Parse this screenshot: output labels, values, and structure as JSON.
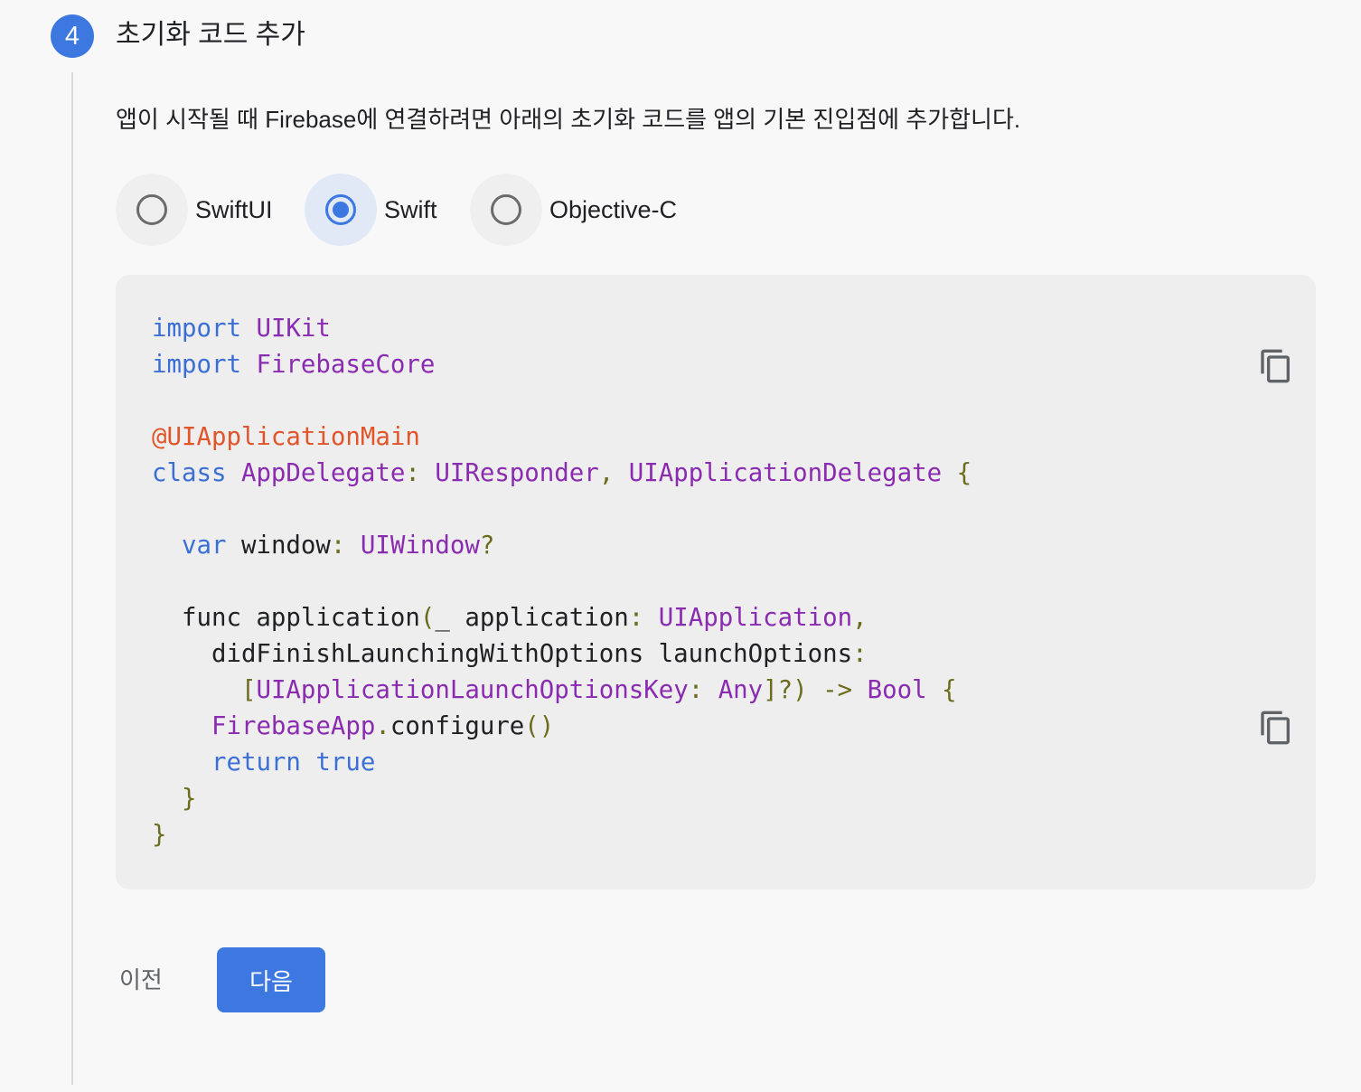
{
  "step": {
    "number": "4",
    "title": "초기화 코드 추가"
  },
  "description": "앱이 시작될 때 Firebase에 연결하려면 아래의 초기화 코드를 앱의 기본 진입점에 추가합니다.",
  "language_options": [
    {
      "label": "SwiftUI",
      "selected": false
    },
    {
      "label": "Swift",
      "selected": true
    },
    {
      "label": "Objective-C",
      "selected": false
    }
  ],
  "code_block": {
    "lines": [
      [
        [
          "kw",
          "import"
        ],
        [
          "pl",
          " "
        ],
        [
          "ty",
          "UIKit"
        ]
      ],
      [
        [
          "kw",
          "import"
        ],
        [
          "pl",
          " "
        ],
        [
          "ty",
          "FirebaseCore"
        ]
      ],
      [],
      [
        [
          "at",
          "@UIApplicationMain"
        ]
      ],
      [
        [
          "kw",
          "class"
        ],
        [
          "pl",
          " "
        ],
        [
          "ty",
          "AppDelegate"
        ],
        [
          "pn",
          ":"
        ],
        [
          "pl",
          " "
        ],
        [
          "ty",
          "UIResponder"
        ],
        [
          "pn",
          ","
        ],
        [
          "pl",
          " "
        ],
        [
          "ty",
          "UIApplicationDelegate"
        ],
        [
          "pl",
          " "
        ],
        [
          "pn",
          "{"
        ]
      ],
      [],
      [
        [
          "pl",
          "  "
        ],
        [
          "kw",
          "var"
        ],
        [
          "pl",
          " window"
        ],
        [
          "pn",
          ":"
        ],
        [
          "pl",
          " "
        ],
        [
          "ty",
          "UIWindow"
        ],
        [
          "pn",
          "?"
        ]
      ],
      [],
      [
        [
          "pl",
          "  func application"
        ],
        [
          "pn",
          "("
        ],
        [
          "pl",
          "_ application"
        ],
        [
          "pn",
          ":"
        ],
        [
          "pl",
          " "
        ],
        [
          "ty",
          "UIApplication"
        ],
        [
          "pn",
          ","
        ]
      ],
      [
        [
          "pl",
          "    didFinishLaunchingWithOptions launchOptions"
        ],
        [
          "pn",
          ":"
        ]
      ],
      [
        [
          "pl",
          "      "
        ],
        [
          "pn",
          "["
        ],
        [
          "ty",
          "UIApplicationLaunchOptionsKey"
        ],
        [
          "pn",
          ":"
        ],
        [
          "pl",
          " "
        ],
        [
          "ty",
          "Any"
        ],
        [
          "pn",
          "]?)"
        ],
        [
          "pl",
          " "
        ],
        [
          "pn",
          "->"
        ],
        [
          "pl",
          " "
        ],
        [
          "ty",
          "Bool"
        ],
        [
          "pl",
          " "
        ],
        [
          "pn",
          "{"
        ]
      ],
      [
        [
          "pl",
          "    "
        ],
        [
          "ty",
          "FirebaseApp"
        ],
        [
          "pn",
          "."
        ],
        [
          "pl",
          "configure"
        ],
        [
          "pn",
          "()"
        ]
      ],
      [
        [
          "pl",
          "    "
        ],
        [
          "kw",
          "return"
        ],
        [
          "pl",
          " "
        ],
        [
          "kw",
          "true"
        ]
      ],
      [
        [
          "pl",
          "  "
        ],
        [
          "pn",
          "}"
        ]
      ],
      [
        [
          "pn",
          "}"
        ]
      ]
    ]
  },
  "buttons": {
    "prev_label": "이전",
    "next_label": "다음"
  },
  "colors": {
    "accent": "#3c78e0",
    "keyword": "#3b6fd6",
    "type": "#8a2bb0",
    "attribute": "#e0552a",
    "punctuation": "#6c6c1e"
  },
  "icons": {
    "copy": "copy-icon"
  }
}
